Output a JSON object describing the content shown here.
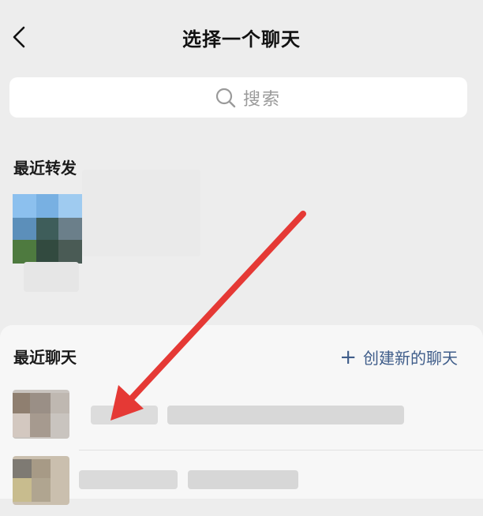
{
  "header": {
    "title": "选择一个聊天"
  },
  "search": {
    "placeholder": "搜索"
  },
  "recent_forward": {
    "label": "最近转发"
  },
  "recent_chats": {
    "label": "最近聊天",
    "new_chat_label": "创建新的聊天"
  },
  "icons": {
    "back": "chevron-left-icon",
    "search": "search-icon",
    "add": "plus-icon"
  },
  "colors": {
    "background": "#ededed",
    "link": "#3f5d8a",
    "annotation_arrow": "#e53935"
  }
}
